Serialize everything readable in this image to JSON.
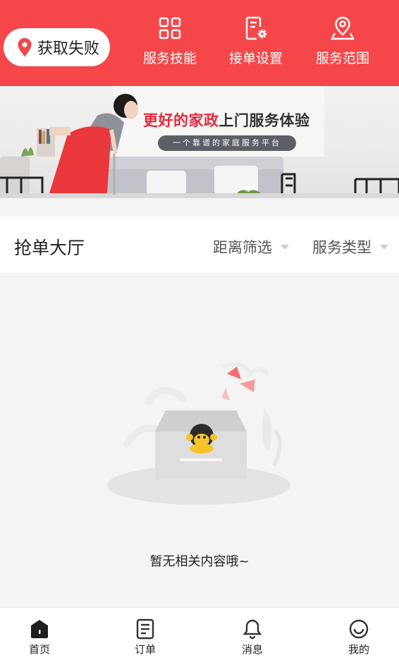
{
  "header": {
    "location_status": "获取失败",
    "nav": [
      {
        "label": "服务技能",
        "icon": "grid-icon"
      },
      {
        "label": "接单设置",
        "icon": "settings-doc-icon"
      },
      {
        "label": "服务范围",
        "icon": "map-pin-icon"
      }
    ]
  },
  "banner": {
    "title_highlight": "更好的家政",
    "title_rest": "上门服务体验",
    "subtitle": "一个靠谱的家庭服务平台"
  },
  "section": {
    "title": "抢单大厅",
    "filters": [
      {
        "label": "距离筛选"
      },
      {
        "label": "服务类型"
      }
    ]
  },
  "empty_state": {
    "message": "暂无相关内容哦~"
  },
  "tabbar": {
    "items": [
      {
        "label": "首页",
        "icon": "home-icon"
      },
      {
        "label": "订单",
        "icon": "order-list-icon"
      },
      {
        "label": "消息",
        "icon": "bell-icon"
      },
      {
        "label": "我的",
        "icon": "smiley-profile-icon"
      }
    ]
  },
  "colors": {
    "brand_red": "#f5474a",
    "banner_accent": "#e6263e"
  }
}
